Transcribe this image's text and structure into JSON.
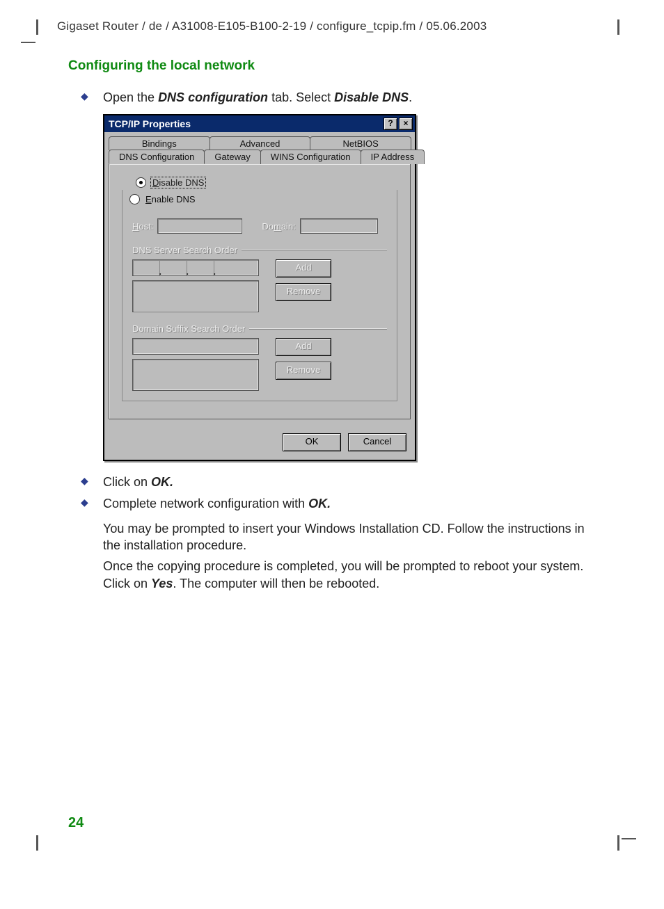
{
  "header": "Gigaset Router / de / A31008-E105-B100-2-19 / configure_tcpip.fm / 05.06.2003",
  "section_title": "Configuring the local network",
  "page_number": "24",
  "bullets_top": {
    "b1_pre": "Open the ",
    "b1_bold1": "DNS configuration",
    "b1_mid": " tab. Select ",
    "b1_bold2": "Disable DNS",
    "b1_post": "."
  },
  "bullets_bottom": {
    "b2_pre": "Click on ",
    "b2_bold": "OK.",
    "b3_pre": "Complete network configuration with ",
    "b3_bold": "OK."
  },
  "paragraphs": {
    "p1": "You may be prompted to insert your Windows Installation CD. Follow the instructions in the installation procedure.",
    "p2_pre": "Once the copying procedure is completed, you will be prompted to reboot your system. Click on ",
    "p2_bold": "Yes",
    "p2_post": ". The computer will then be rebooted."
  },
  "dialog": {
    "title": "TCP/IP Properties",
    "help_btn": "?",
    "close_btn": "×",
    "tabs_row1": [
      "Bindings",
      "Advanced",
      "NetBIOS"
    ],
    "tabs_row2": [
      "DNS Configuration",
      "Gateway",
      "WINS Configuration",
      "IP Address"
    ],
    "radio_disable_u": "D",
    "radio_disable_rest": "isable DNS",
    "radio_enable_u": "E",
    "radio_enable_rest": "nable DNS",
    "host_label_u": "H",
    "host_label_rest": "ost:",
    "domain_label_u": "m",
    "domain_label_pre": "Do",
    "domain_label_post": "ain:",
    "dns_order_label": "DNS Server Search Order",
    "suffix_order_label": "Domain Suffix Search Order",
    "add_btn_u": "A",
    "add_btn_rest": "dd",
    "remove_btn_pre": "Re",
    "remove_btn_u": "m",
    "remove_btn_post": "ove",
    "ok_btn": "OK",
    "cancel_btn": "Cancel"
  }
}
